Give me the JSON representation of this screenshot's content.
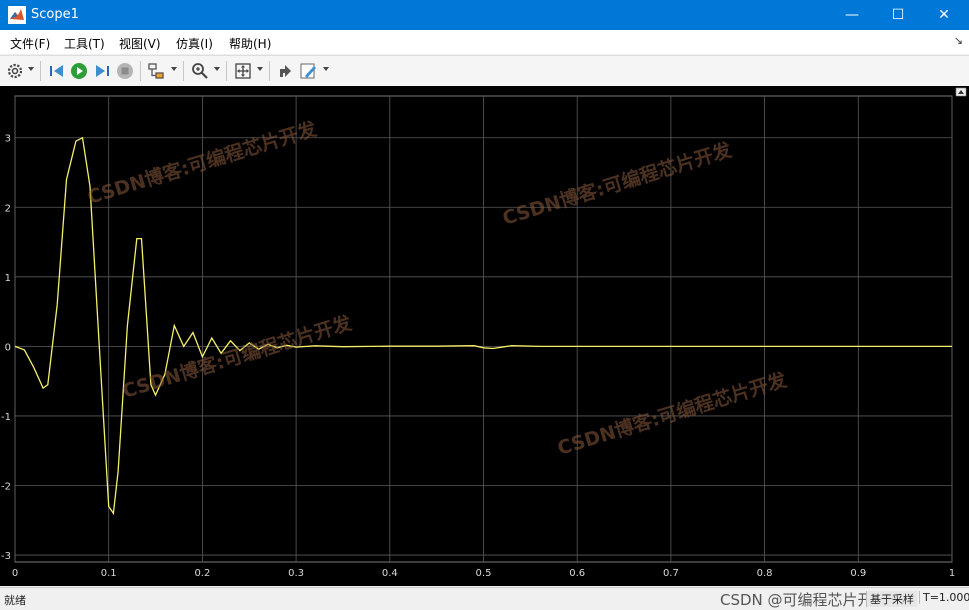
{
  "window": {
    "title": "Scope1",
    "minimize": "—",
    "maximize": "☐",
    "close": "✕"
  },
  "menu": [
    "文件(F)",
    "工具(T)",
    "视图(V)",
    "仿真(I)",
    "帮助(H)"
  ],
  "toolbar": {
    "icons": [
      "settings-icon",
      "step-back-icon",
      "run-icon",
      "step-forward-icon",
      "stop-icon",
      "highlight-block-icon",
      "zoom-icon",
      "autoscale-icon",
      "restore-icon",
      "style-icon"
    ]
  },
  "watermarks": [
    "CSDN博客:可编程芯片开发",
    "CSDN博客:可编程芯片开发",
    "CSDN博客:可编程芯片开发",
    "CSDN博客:可编程芯片开发"
  ],
  "status": {
    "left": "就绪",
    "mode": "基于采样",
    "time": "T=1.000"
  },
  "footer_watermark": "CSDN @可编程芯片开发",
  "colors": {
    "signal": "#f5f06a",
    "plot_bg": "#000000",
    "grid": "#5a5a5a",
    "titlebar": "#0078d7"
  },
  "chart_data": {
    "type": "line",
    "title": "",
    "xlabel": "",
    "ylabel": "",
    "xlim": [
      0,
      1
    ],
    "ylim": [
      -3.1,
      3.6
    ],
    "xticks": [
      0,
      0.1,
      0.2,
      0.3,
      0.4,
      0.5,
      0.6,
      0.7,
      0.8,
      0.9,
      1
    ],
    "yticks": [
      -3,
      -2,
      -1,
      0,
      1,
      2,
      3
    ],
    "grid": true,
    "series": [
      {
        "x": [
          0,
          0.01,
          0.02,
          0.03,
          0.035,
          0.045,
          0.055,
          0.065,
          0.072,
          0.08,
          0.09,
          0.1,
          0.105,
          0.11,
          0.12,
          0.13,
          0.135,
          0.14,
          0.145,
          0.15,
          0.16,
          0.17,
          0.18,
          0.19,
          0.2,
          0.21,
          0.22,
          0.23,
          0.24,
          0.25,
          0.26,
          0.27,
          0.28,
          0.29,
          0.3,
          0.32,
          0.35,
          0.4,
          0.45,
          0.49,
          0.5,
          0.51,
          0.53,
          0.56,
          0.6,
          0.7,
          0.8,
          0.9,
          1.0
        ],
        "y": [
          0,
          -0.05,
          -0.3,
          -0.6,
          -0.55,
          0.6,
          2.4,
          2.95,
          3.0,
          2.3,
          0.0,
          -2.3,
          -2.4,
          -1.8,
          0.3,
          1.55,
          1.55,
          0.5,
          -0.55,
          -0.7,
          -0.4,
          0.3,
          0.0,
          0.2,
          -0.15,
          0.12,
          -0.1,
          0.08,
          -0.06,
          0.05,
          -0.04,
          0.03,
          -0.02,
          0.015,
          -0.01,
          0.008,
          -0.005,
          0.003,
          0.002,
          0.01,
          -0.02,
          -0.03,
          0.01,
          0.0,
          0.0,
          0.0,
          0.0,
          0.0,
          0.0
        ]
      }
    ]
  }
}
